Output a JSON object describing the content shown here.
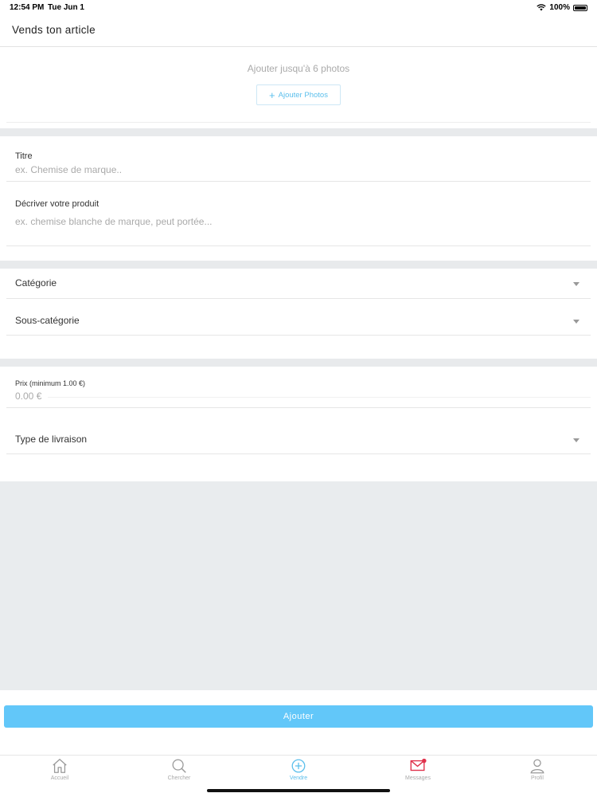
{
  "status": {
    "time": "12:54 PM",
    "date": "Tue Jun 1",
    "battery": "100%"
  },
  "header": {
    "title": "Vends ton article"
  },
  "photos": {
    "hint": "Ajouter jusqu'à 6 photos",
    "button_label": "Ajouter Photos"
  },
  "form": {
    "title_label": "Titre",
    "title_placeholder": "ex. Chemise de marque..",
    "description_label": "Décriver votre produit",
    "description_placeholder": "ex. chemise blanche de marque, peut portée...",
    "category_label": "Catégorie",
    "subcategory_label": "Sous-catégorie",
    "price_label": "Prix (minimum 1.00 €)",
    "price_placeholder": "0.00 €",
    "delivery_label": "Type de livraison"
  },
  "submit": {
    "label": "Ajouter"
  },
  "tabs": [
    {
      "label": "Accueil",
      "icon": "home-icon"
    },
    {
      "label": "Chercher",
      "icon": "search-icon"
    },
    {
      "label": "Vendre",
      "icon": "plus-circle-icon"
    },
    {
      "label": "Messages",
      "icon": "mail-icon"
    },
    {
      "label": "Profil",
      "icon": "user-icon"
    }
  ],
  "colors": {
    "accent": "#62c7f9",
    "notification": "#e0314b",
    "separator": "#e8eaec"
  }
}
